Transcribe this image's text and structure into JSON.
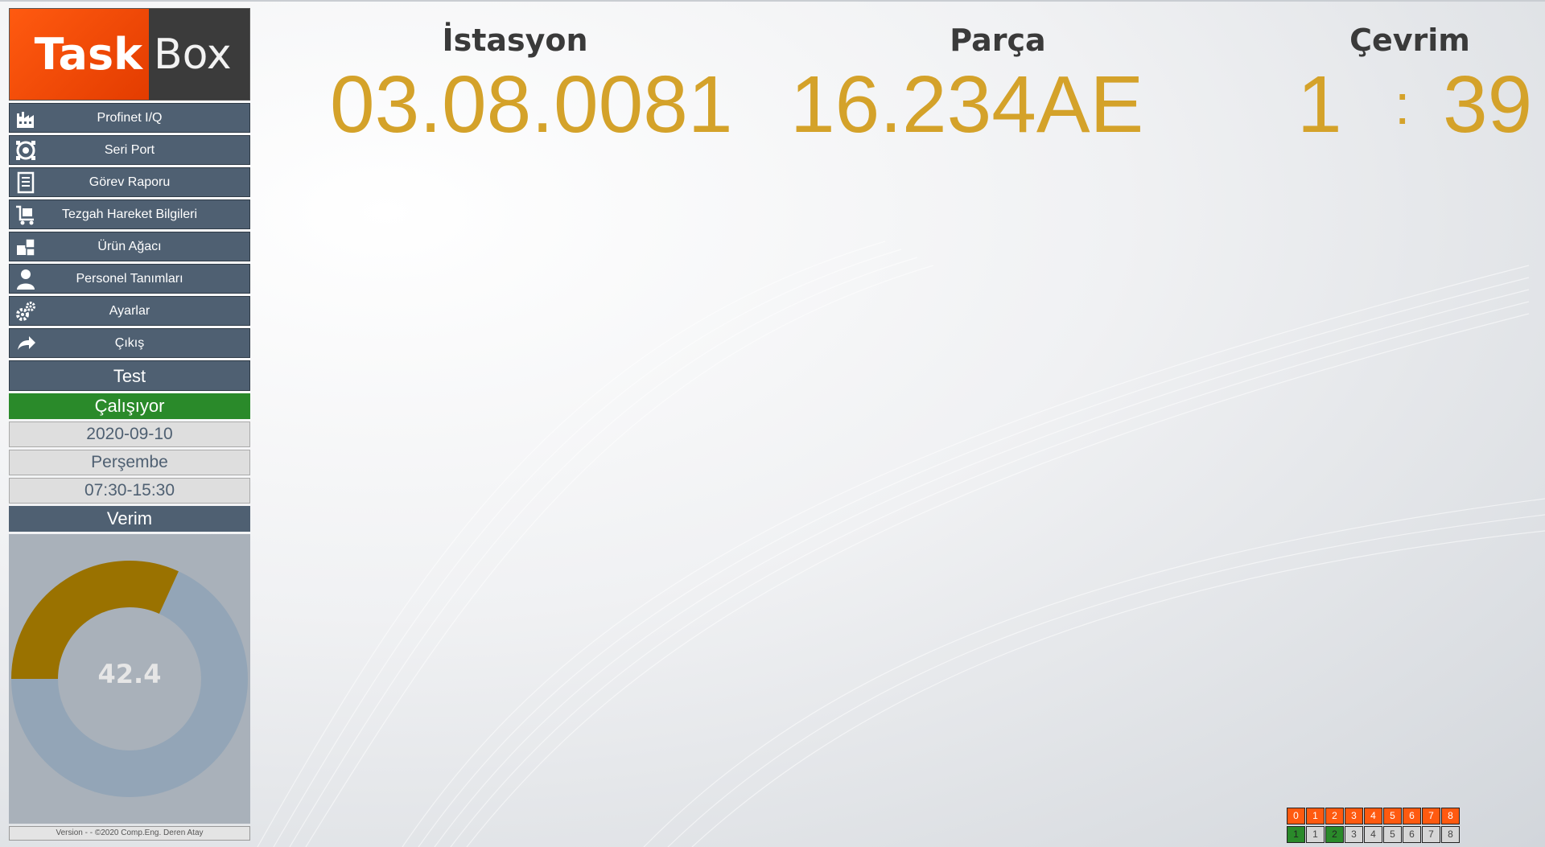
{
  "app": {
    "logo_primary": "Task",
    "logo_secondary": "Box"
  },
  "sidebar": {
    "items": [
      {
        "label": "Profinet I/Q",
        "icon": "factory-icon"
      },
      {
        "label": "Seri Port",
        "icon": "serial-port-icon"
      },
      {
        "label": "Görev Raporu",
        "icon": "report-icon"
      },
      {
        "label": "Tezgah Hareket Bilgileri",
        "icon": "cart-icon"
      },
      {
        "label": "Ürün Ağacı",
        "icon": "boxes-icon"
      },
      {
        "label": "Personel Tanımları",
        "icon": "user-icon"
      },
      {
        "label": "Ayarlar",
        "icon": "gears-icon"
      },
      {
        "label": "Çıkış",
        "icon": "exit-arrow-icon"
      }
    ],
    "test_label": "Test",
    "status_label": "Çalışıyor",
    "date": "2020-09-10",
    "day": "Perşembe",
    "shift": "07:30-15:30",
    "verim_label": "Verim",
    "verim_value": "42.4",
    "verim_fraction": 0.424,
    "version": "Version -  -  ©2020 Comp.Eng. Deren Atay"
  },
  "header": {
    "station_label": "İstasyon",
    "station_value": "03.08.0081",
    "part_label": "Parça",
    "part_value": "16.234AE",
    "cycle_label": "Çevrim",
    "cycle_minutes": "1",
    "cycle_separator": ":",
    "cycle_seconds": "39"
  },
  "io": {
    "outputs": [
      {
        "label": "0",
        "state": "on"
      },
      {
        "label": "1",
        "state": "on"
      },
      {
        "label": "2",
        "state": "on"
      },
      {
        "label": "3",
        "state": "on"
      },
      {
        "label": "4",
        "state": "on"
      },
      {
        "label": "5",
        "state": "on"
      },
      {
        "label": "6",
        "state": "on"
      },
      {
        "label": "7",
        "state": "on"
      },
      {
        "label": "8",
        "state": "on"
      }
    ],
    "inputs": [
      {
        "label": "1",
        "state": "active"
      },
      {
        "label": "1",
        "state": "off"
      },
      {
        "label": "2",
        "state": "active"
      },
      {
        "label": "3",
        "state": "off"
      },
      {
        "label": "4",
        "state": "off"
      },
      {
        "label": "5",
        "state": "off"
      },
      {
        "label": "6",
        "state": "off"
      },
      {
        "label": "7",
        "state": "off"
      },
      {
        "label": "8",
        "state": "off"
      }
    ]
  },
  "colors": {
    "accent_orange": "#ff5a10",
    "gold": "#d4a22a",
    "menu_bg": "#4f6072",
    "status_green": "#2a8a2a",
    "gauge_fill": "#9a7200",
    "gauge_track": "#8fa3b6"
  }
}
